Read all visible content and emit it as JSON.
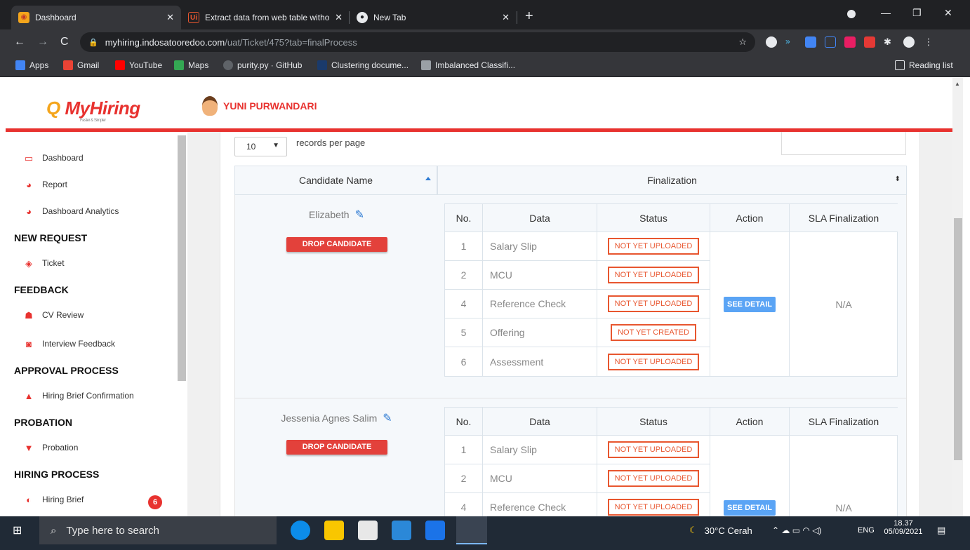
{
  "browser": {
    "tabs": [
      {
        "title": "Dashboard",
        "active": true
      },
      {
        "title": "Extract data from web table witho",
        "active": false
      },
      {
        "title": "New Tab",
        "active": false
      }
    ],
    "url_domain": "myhiring.indosatooredoo.com",
    "url_path": "/uat/Ticket/475?tab=finalProcess",
    "bookmarks": [
      "Apps",
      "Gmail",
      "YouTube",
      "Maps",
      "purity.py · GitHub",
      "Clustering docume...",
      "Imbalanced Classifi..."
    ],
    "reading_list": "Reading list"
  },
  "header": {
    "logo": "MyHiring",
    "logo_sub": "Faster & Simpler",
    "user_name": "YUNI PURWANDARI"
  },
  "sidebar": {
    "items": [
      {
        "label": "Dashboard",
        "icon": "dashboard-icon"
      },
      {
        "label": "Report",
        "icon": "gauge-icon"
      },
      {
        "label": "Dashboard Analytics",
        "icon": "gauge-icon"
      }
    ],
    "sections": [
      {
        "title": "NEW REQUEST",
        "items": [
          "Ticket"
        ]
      },
      {
        "title": "FEEDBACK",
        "items": [
          "CV Review",
          "Interview Feedback"
        ]
      },
      {
        "title": "APPROVAL PROCESS",
        "items": [
          "Hiring Brief Confirmation"
        ]
      },
      {
        "title": "PROBATION",
        "items": [
          "Probation"
        ]
      },
      {
        "title": "HIRING PROCESS",
        "items": [
          "Hiring Brief"
        ]
      }
    ],
    "hiring_brief_badge": "6"
  },
  "table": {
    "page_size": "10",
    "records_label": "records per page",
    "col_candidate": "Candidate Name",
    "col_finalization": "Finalization",
    "inner_headers": [
      "No.",
      "Data",
      "Status",
      "Action",
      "SLA Finalization"
    ],
    "drop_label": "DROP CANDIDATE",
    "see_detail": "SEE DETAIL",
    "candidates": [
      {
        "name": "Elizabeth",
        "rows": [
          {
            "no": "1",
            "data": "Salary Slip",
            "status": "NOT YET UPLOADED"
          },
          {
            "no": "2",
            "data": "MCU",
            "status": "NOT YET UPLOADED"
          },
          {
            "no": "4",
            "data": "Reference Check",
            "status": "NOT YET UPLOADED"
          },
          {
            "no": "5",
            "data": "Offering",
            "status": "NOT YET CREATED"
          },
          {
            "no": "6",
            "data": "Assessment",
            "status": "NOT YET UPLOADED"
          }
        ],
        "sla": "N/A"
      },
      {
        "name": "Jessenia Agnes Salim",
        "rows": [
          {
            "no": "1",
            "data": "Salary Slip",
            "status": "NOT YET UPLOADED"
          },
          {
            "no": "2",
            "data": "MCU",
            "status": "NOT YET UPLOADED"
          },
          {
            "no": "4",
            "data": "Reference Check",
            "status": "NOT YET UPLOADED"
          }
        ],
        "sla": "N/A"
      }
    ]
  },
  "taskbar": {
    "search_placeholder": "Type here to search",
    "weather": "30°C  Cerah",
    "lang": "ENG",
    "time": "18.37",
    "date": "05/09/2021"
  }
}
